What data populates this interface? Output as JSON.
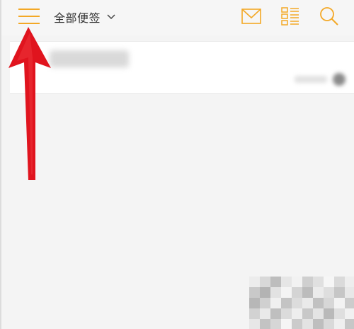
{
  "header": {
    "title": "全部便签",
    "icons": {
      "menu": "hamburger-menu-icon",
      "dropdown": "chevron-down-icon",
      "mail": "mail-icon",
      "list": "list-layout-icon",
      "search": "search-icon"
    }
  },
  "colors": {
    "accent": "#f3a826",
    "arrow": "#e0141e",
    "background": "#f4f4f4",
    "card": "#ffffff",
    "title_text": "#333333"
  },
  "notes": [
    {
      "title": "",
      "time": ""
    }
  ]
}
